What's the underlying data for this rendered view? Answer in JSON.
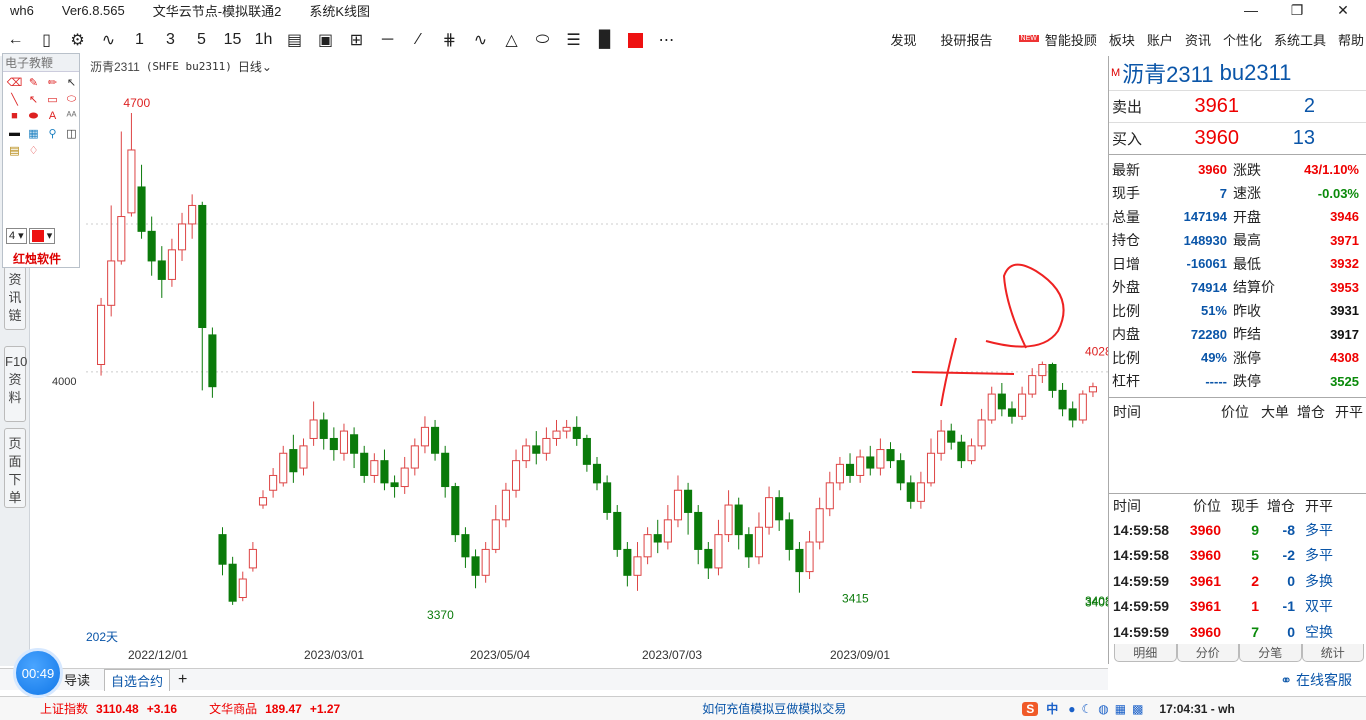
{
  "titlebar": {
    "app": "wh6",
    "version": "Ver6.8.565",
    "node": "文华云节点-模拟联通2",
    "view": "系统K线图"
  },
  "toolbar": {
    "periods": [
      "1",
      "3",
      "5",
      "15",
      "1h"
    ]
  },
  "topmenu": {
    "items": [
      "发现",
      "投研报告",
      "智能投顾",
      "板块",
      "账户",
      "资讯",
      "个性化",
      "系统工具",
      "帮助"
    ],
    "new_badge": "NEW"
  },
  "chart_header": {
    "symbol": "沥青2311",
    "exchange": "(SHFE bu2311)",
    "period": "日线"
  },
  "drawing_panel": {
    "title": "电子教鞭",
    "line_width": "4",
    "brand": "红烛软件"
  },
  "left_tabs": [
    {
      "label": "资讯链"
    },
    {
      "label": "F10资料"
    },
    {
      "label": "页面下单"
    }
  ],
  "chart_data": {
    "type": "candlestick",
    "price_axis_labels": [
      "4000"
    ],
    "x_tick_labels": [
      "2022/12/01",
      "2023/03/01",
      "2023/05/04",
      "2023/07/03",
      "2023/09/01"
    ],
    "days_label": "202天",
    "annotations": [
      {
        "label": "4700",
        "date_idx": 3,
        "price": 4700
      },
      {
        "label": "3370",
        "date_idx": 33,
        "price": 3370
      },
      {
        "label": "3415",
        "date_idx": 74,
        "price": 3415
      },
      {
        "label": "3408",
        "date_idx": 107,
        "price": 3408
      },
      {
        "label": "3403",
        "date_idx": 141,
        "price": 3403
      },
      {
        "label": "4028",
        "date_idx": 192,
        "price": 4028
      }
    ],
    "price_range": [
      3340,
      4800
    ],
    "candles": [
      {
        "o": 4020,
        "c": 4180,
        "h": 4200,
        "l": 3990
      },
      {
        "o": 4180,
        "c": 4300,
        "h": 4450,
        "l": 4150
      },
      {
        "o": 4300,
        "c": 4420,
        "h": 4650,
        "l": 4290
      },
      {
        "o": 4430,
        "c": 4600,
        "h": 4700,
        "l": 4420
      },
      {
        "o": 4500,
        "c": 4380,
        "h": 4560,
        "l": 4360
      },
      {
        "o": 4380,
        "c": 4300,
        "h": 4420,
        "l": 4260
      },
      {
        "o": 4300,
        "c": 4250,
        "h": 4340,
        "l": 4200
      },
      {
        "o": 4250,
        "c": 4330,
        "h": 4360,
        "l": 4230
      },
      {
        "o": 4330,
        "c": 4400,
        "h": 4430,
        "l": 4300
      },
      {
        "o": 4400,
        "c": 4450,
        "h": 4480,
        "l": 4360
      },
      {
        "o": 4450,
        "c": 4120,
        "h": 4460,
        "l": 3950
      },
      {
        "o": 4100,
        "c": 3960,
        "h": 4120,
        "l": 3930
      },
      {
        "o": 3560,
        "c": 3480,
        "h": 3580,
        "l": 3450
      },
      {
        "o": 3480,
        "c": 3380,
        "h": 3500,
        "l": 3370
      },
      {
        "o": 3390,
        "c": 3440,
        "h": 3460,
        "l": 3380
      },
      {
        "o": 3470,
        "c": 3520,
        "h": 3540,
        "l": 3460
      },
      {
        "o": 3640,
        "c": 3660,
        "h": 3680,
        "l": 3630
      },
      {
        "o": 3680,
        "c": 3720,
        "h": 3740,
        "l": 3660
      },
      {
        "o": 3700,
        "c": 3780,
        "h": 3800,
        "l": 3690
      },
      {
        "o": 3790,
        "c": 3730,
        "h": 3830,
        "l": 3700
      },
      {
        "o": 3740,
        "c": 3800,
        "h": 3820,
        "l": 3720
      },
      {
        "o": 3820,
        "c": 3870,
        "h": 3920,
        "l": 3800
      },
      {
        "o": 3870,
        "c": 3820,
        "h": 3890,
        "l": 3790
      },
      {
        "o": 3820,
        "c": 3790,
        "h": 3850,
        "l": 3760
      },
      {
        "o": 3780,
        "c": 3840,
        "h": 3860,
        "l": 3760
      },
      {
        "o": 3830,
        "c": 3780,
        "h": 3850,
        "l": 3740
      },
      {
        "o": 3780,
        "c": 3720,
        "h": 3800,
        "l": 3700
      },
      {
        "o": 3720,
        "c": 3760,
        "h": 3780,
        "l": 3700
      },
      {
        "o": 3760,
        "c": 3700,
        "h": 3790,
        "l": 3680
      },
      {
        "o": 3700,
        "c": 3690,
        "h": 3720,
        "l": 3660
      },
      {
        "o": 3690,
        "c": 3740,
        "h": 3770,
        "l": 3670
      },
      {
        "o": 3740,
        "c": 3800,
        "h": 3820,
        "l": 3720
      },
      {
        "o": 3800,
        "c": 3850,
        "h": 3880,
        "l": 3780
      },
      {
        "o": 3850,
        "c": 3780,
        "h": 3870,
        "l": 3760
      },
      {
        "o": 3780,
        "c": 3690,
        "h": 3800,
        "l": 3660
      },
      {
        "o": 3690,
        "c": 3560,
        "h": 3700,
        "l": 3540
      },
      {
        "o": 3560,
        "c": 3500,
        "h": 3580,
        "l": 3470
      },
      {
        "o": 3500,
        "c": 3450,
        "h": 3520,
        "l": 3415
      },
      {
        "o": 3450,
        "c": 3520,
        "h": 3540,
        "l": 3430
      },
      {
        "o": 3520,
        "c": 3600,
        "h": 3640,
        "l": 3510
      },
      {
        "o": 3600,
        "c": 3680,
        "h": 3700,
        "l": 3580
      },
      {
        "o": 3680,
        "c": 3760,
        "h": 3790,
        "l": 3660
      },
      {
        "o": 3760,
        "c": 3800,
        "h": 3820,
        "l": 3740
      },
      {
        "o": 3800,
        "c": 3780,
        "h": 3840,
        "l": 3750
      },
      {
        "o": 3780,
        "c": 3820,
        "h": 3850,
        "l": 3760
      },
      {
        "o": 3820,
        "c": 3840,
        "h": 3870,
        "l": 3800
      },
      {
        "o": 3840,
        "c": 3850,
        "h": 3870,
        "l": 3820
      },
      {
        "o": 3850,
        "c": 3820,
        "h": 3880,
        "l": 3800
      },
      {
        "o": 3820,
        "c": 3750,
        "h": 3830,
        "l": 3730
      },
      {
        "o": 3750,
        "c": 3700,
        "h": 3770,
        "l": 3680
      },
      {
        "o": 3700,
        "c": 3620,
        "h": 3720,
        "l": 3600
      },
      {
        "o": 3620,
        "c": 3520,
        "h": 3640,
        "l": 3500
      },
      {
        "o": 3520,
        "c": 3450,
        "h": 3540,
        "l": 3420
      },
      {
        "o": 3450,
        "c": 3500,
        "h": 3540,
        "l": 3408
      },
      {
        "o": 3500,
        "c": 3560,
        "h": 3580,
        "l": 3480
      },
      {
        "o": 3560,
        "c": 3540,
        "h": 3600,
        "l": 3510
      },
      {
        "o": 3540,
        "c": 3600,
        "h": 3640,
        "l": 3520
      },
      {
        "o": 3600,
        "c": 3680,
        "h": 3720,
        "l": 3580
      },
      {
        "o": 3680,
        "c": 3620,
        "h": 3700,
        "l": 3560
      },
      {
        "o": 3620,
        "c": 3520,
        "h": 3640,
        "l": 3480
      },
      {
        "o": 3520,
        "c": 3470,
        "h": 3540,
        "l": 3440
      },
      {
        "o": 3470,
        "c": 3560,
        "h": 3600,
        "l": 3450
      },
      {
        "o": 3560,
        "c": 3640,
        "h": 3680,
        "l": 3540
      },
      {
        "o": 3640,
        "c": 3560,
        "h": 3660,
        "l": 3520
      },
      {
        "o": 3560,
        "c": 3500,
        "h": 3580,
        "l": 3470
      },
      {
        "o": 3500,
        "c": 3580,
        "h": 3620,
        "l": 3480
      },
      {
        "o": 3580,
        "c": 3660,
        "h": 3690,
        "l": 3560
      },
      {
        "o": 3660,
        "c": 3600,
        "h": 3680,
        "l": 3570
      },
      {
        "o": 3600,
        "c": 3520,
        "h": 3620,
        "l": 3490
      },
      {
        "o": 3520,
        "c": 3460,
        "h": 3540,
        "l": 3403
      },
      {
        "o": 3460,
        "c": 3540,
        "h": 3570,
        "l": 3440
      },
      {
        "o": 3540,
        "c": 3630,
        "h": 3660,
        "l": 3520
      },
      {
        "o": 3630,
        "c": 3700,
        "h": 3730,
        "l": 3610
      },
      {
        "o": 3700,
        "c": 3750,
        "h": 3770,
        "l": 3680
      },
      {
        "o": 3750,
        "c": 3720,
        "h": 3780,
        "l": 3700
      },
      {
        "o": 3720,
        "c": 3770,
        "h": 3790,
        "l": 3700
      },
      {
        "o": 3770,
        "c": 3740,
        "h": 3800,
        "l": 3720
      },
      {
        "o": 3740,
        "c": 3790,
        "h": 3820,
        "l": 3720
      },
      {
        "o": 3790,
        "c": 3760,
        "h": 3810,
        "l": 3740
      },
      {
        "o": 3760,
        "c": 3700,
        "h": 3780,
        "l": 3680
      },
      {
        "o": 3700,
        "c": 3650,
        "h": 3720,
        "l": 3630
      },
      {
        "o": 3650,
        "c": 3700,
        "h": 3730,
        "l": 3630
      },
      {
        "o": 3700,
        "c": 3780,
        "h": 3820,
        "l": 3690
      },
      {
        "o": 3780,
        "c": 3840,
        "h": 3870,
        "l": 3760
      },
      {
        "o": 3840,
        "c": 3810,
        "h": 3860,
        "l": 3790
      },
      {
        "o": 3810,
        "c": 3760,
        "h": 3830,
        "l": 3740
      },
      {
        "o": 3760,
        "c": 3800,
        "h": 3820,
        "l": 3750
      },
      {
        "o": 3800,
        "c": 3870,
        "h": 3900,
        "l": 3790
      },
      {
        "o": 3870,
        "c": 3940,
        "h": 3960,
        "l": 3860
      },
      {
        "o": 3940,
        "c": 3900,
        "h": 3970,
        "l": 3880
      },
      {
        "o": 3900,
        "c": 3880,
        "h": 3920,
        "l": 3860
      },
      {
        "o": 3880,
        "c": 3940,
        "h": 3960,
        "l": 3870
      },
      {
        "o": 3940,
        "c": 3990,
        "h": 4010,
        "l": 3930
      },
      {
        "o": 3990,
        "c": 4020,
        "h": 4028,
        "l": 3970
      },
      {
        "o": 4020,
        "c": 3950,
        "h": 4025,
        "l": 3930
      },
      {
        "o": 3950,
        "c": 3900,
        "h": 3970,
        "l": 3880
      },
      {
        "o": 3900,
        "c": 3870,
        "h": 3920,
        "l": 3850
      },
      {
        "o": 3870,
        "c": 3940,
        "h": 3950,
        "l": 3860
      },
      {
        "o": 3946,
        "c": 3960,
        "h": 3971,
        "l": 3932
      }
    ]
  },
  "quote": {
    "symbol_prefix": "M",
    "name": "沥青2311",
    "code": "bu2311",
    "ask": {
      "label": "卖出",
      "price": "3961",
      "volume": "2"
    },
    "bid": {
      "label": "买入",
      "price": "3960",
      "volume": "13"
    },
    "rows": [
      {
        "l1": "最新",
        "v1": "3960",
        "c1": "red",
        "l2": "涨跌",
        "v2": "43/1.10%",
        "c2": "red"
      },
      {
        "l1": "现手",
        "v1": "7",
        "c1": "blue",
        "l2": "速涨",
        "v2": "-0.03%",
        "c2": "green"
      },
      {
        "l1": "总量",
        "v1": "147194",
        "c1": "blue",
        "l2": "开盘",
        "v2": "3946",
        "c2": "red"
      },
      {
        "l1": "持仓",
        "v1": "148930",
        "c1": "blue",
        "l2": "最高",
        "v2": "3971",
        "c2": "red"
      },
      {
        "l1": "日增",
        "v1": "-16061",
        "c1": "blue",
        "l2": "最低",
        "v2": "3932",
        "c2": "red"
      },
      {
        "l1": "外盘",
        "v1": "74914",
        "c1": "blue",
        "l2": "结算价",
        "v2": "3953",
        "c2": "red"
      },
      {
        "l1": "比例",
        "v1": "51%",
        "c1": "blue",
        "l2": "昨收",
        "v2": "3931",
        "c2": "black"
      },
      {
        "l1": "内盘",
        "v1": "72280",
        "c1": "blue",
        "l2": "昨结",
        "v2": "3917",
        "c2": "black"
      },
      {
        "l1": "比例",
        "v1": "49%",
        "c1": "blue",
        "l2": "涨停",
        "v2": "4308",
        "c2": "red"
      },
      {
        "l1": "杠杆",
        "v1": "-----",
        "c1": "blue",
        "l2": "跌停",
        "v2": "3525",
        "c2": "green"
      }
    ]
  },
  "big_orders": {
    "headers": [
      "时间",
      "价位",
      "大单",
      "增仓",
      "开平"
    ]
  },
  "ticks": {
    "headers": [
      "时间",
      "价位",
      "现手",
      "增仓",
      "开平"
    ],
    "rows": [
      {
        "time": "14:59:58",
        "price": "3960",
        "vol": "9",
        "vc": "green",
        "oi": "-8",
        "type": "多平"
      },
      {
        "time": "14:59:58",
        "price": "3960",
        "vol": "5",
        "vc": "green",
        "oi": "-2",
        "type": "多平"
      },
      {
        "time": "14:59:59",
        "price": "3961",
        "vol": "2",
        "vc": "red",
        "oi": "0",
        "type": "多换"
      },
      {
        "time": "14:59:59",
        "price": "3961",
        "vol": "1",
        "vc": "red",
        "oi": "-1",
        "type": "双平"
      },
      {
        "time": "14:59:59",
        "price": "3960",
        "vol": "7",
        "vc": "green",
        "oi": "0",
        "type": "空换"
      }
    ]
  },
  "right_tabs": [
    "明细",
    "分价",
    "分笔",
    "统计"
  ],
  "bottom_tabs": [
    "导读",
    "自选合约",
    "+"
  ],
  "statusbar": {
    "index1_name": "上证指数",
    "index1_value": "3110.48",
    "index1_change": "+3.16",
    "index2_name": "文华商品",
    "index2_value": "189.47",
    "index2_change": "+1.27",
    "marquee": "如何充值模拟豆做模拟交易",
    "ime": "中",
    "time": "17:04:31 - wh"
  },
  "service": "在线客服",
  "timer": "00:49"
}
